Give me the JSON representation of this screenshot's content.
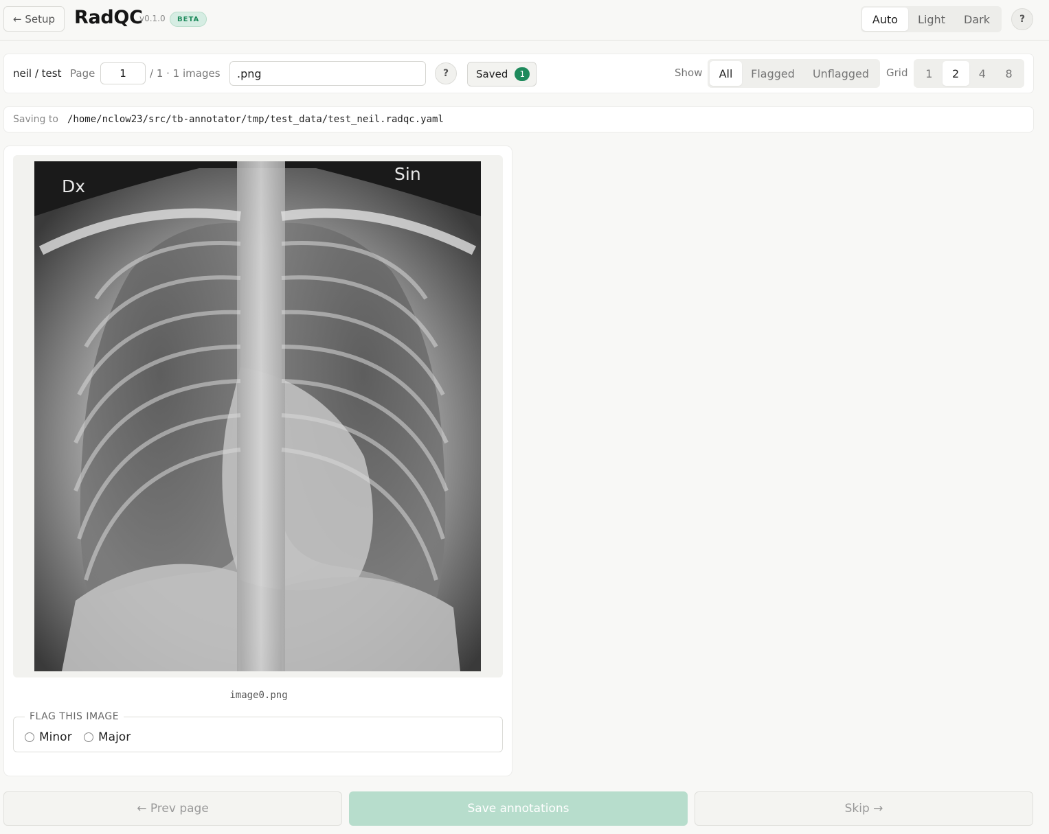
{
  "header": {
    "back_label": "← Setup",
    "app_title": "RadQC",
    "version": "v0.1.0",
    "beta_badge": "BETA",
    "theme_options": [
      "Auto",
      "Light",
      "Dark"
    ],
    "theme_selected": "Auto",
    "help_label": "?"
  },
  "toolbar": {
    "breadcrumb": "neil / test",
    "page_label": "Page",
    "page_value": "1",
    "page_total": "/ 1 · 1 images",
    "filter_value": ".png",
    "filter_help_label": "?",
    "saved_label": "Saved",
    "saved_count": "1",
    "show_label": "Show",
    "show_options": [
      "All",
      "Flagged",
      "Unflagged"
    ],
    "show_selected": "All",
    "grid_label": "Grid",
    "grid_options": [
      "1",
      "2",
      "4",
      "8"
    ],
    "grid_selected": "2"
  },
  "saving": {
    "label": "Saving to",
    "path": "/home/nclow23/src/tb-annotator/tmp/test_data/test_neil.radqc.yaml"
  },
  "image_card": {
    "marker_left": "Dx",
    "marker_right": "Sin",
    "filename": "image0.png",
    "flag_legend": "FLAG THIS IMAGE",
    "flag_options": [
      "Minor",
      "Major"
    ]
  },
  "footer": {
    "prev_label": "← Prev page",
    "save_label": "Save annotations",
    "skip_label": "Skip →"
  },
  "colors": {
    "accent": "#1e8a5c",
    "save_disabled": "#b7ddcc",
    "background": "#f8f8f6"
  }
}
